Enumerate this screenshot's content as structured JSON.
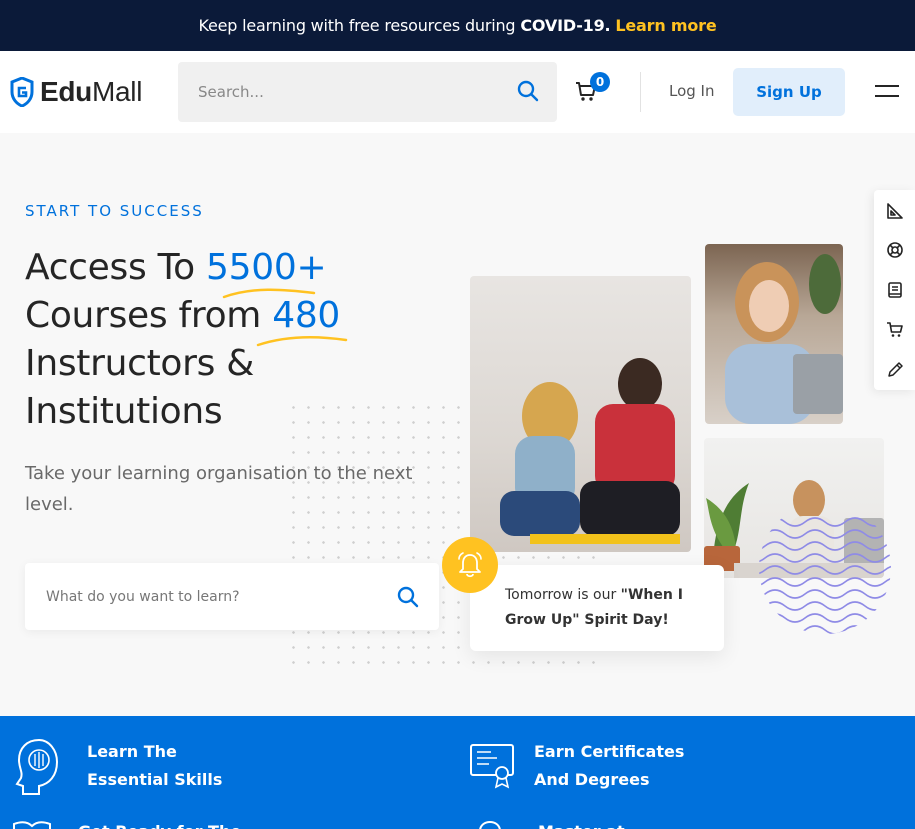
{
  "banner": {
    "text": "Keep learning with free resources during",
    "strong": "COVID-19.",
    "link": "Learn more"
  },
  "header": {
    "logo_bold": "Edu",
    "logo_light": "Mall",
    "search_placeholder": "Search...",
    "cart_count": "0",
    "login_label": "Log In",
    "signup_label": "Sign Up"
  },
  "hero": {
    "eyebrow": "START TO SUCCESS",
    "line1_a": "Access To ",
    "line1_hl": "5500+",
    "line2_a": "Courses from ",
    "line2_hl": "480",
    "line3": "Instructors &",
    "line4": "Institutions",
    "subtext": "Take your learning organisation to the next level.",
    "learn_placeholder": "What do you want to learn?"
  },
  "notice": {
    "pre": "Tomorrow is our ",
    "bold": "\"When I Grow Up\" Spirit Day!"
  },
  "features": [
    {
      "line1": "Learn The",
      "line2": "Essential Skills",
      "icon": "head-circuit-icon"
    },
    {
      "line1": "Earn Certificates",
      "line2": "And Degrees",
      "icon": "certificate-icon"
    },
    {
      "line1": "Get Ready for The",
      "line2": "",
      "icon": "book-icon"
    },
    {
      "line1": "Master at",
      "line2": "",
      "icon": "target-icon"
    }
  ],
  "colors": {
    "brand_blue": "#0071dc",
    "navy": "#0b1a39",
    "accent_yellow": "#ffc221"
  }
}
